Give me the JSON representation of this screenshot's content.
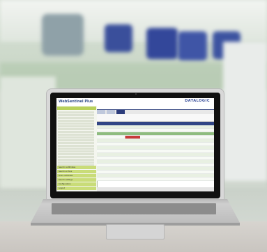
{
  "screen": {
    "app_title": "WebSentinel Plus",
    "brand": "DATALOGIC",
    "left_menu": [
      "Search certificates",
      "Search archive",
      "Scan certificate",
      "Search settings",
      "Configuration",
      "Logout"
    ],
    "table_rows": 16
  },
  "colors": {
    "accent": "#2c3c7b",
    "ok": "#8ebc7f",
    "alert": "#c73a3a"
  }
}
